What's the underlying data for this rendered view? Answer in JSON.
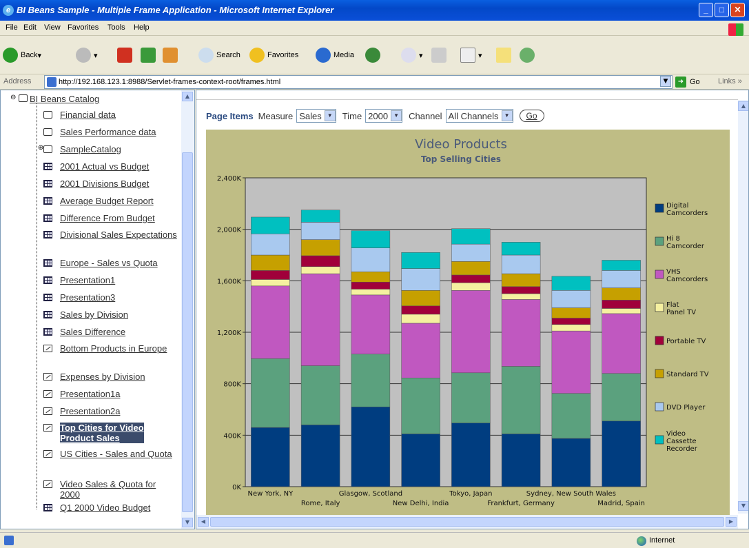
{
  "window": {
    "title": "BI Beans Sample - Multiple Frame Application - Microsoft Internet Explorer"
  },
  "menu": {
    "items": [
      "File",
      "Edit",
      "View",
      "Favorites",
      "Tools",
      "Help"
    ]
  },
  "toolbar": {
    "back": "Back",
    "search": "Search",
    "favorites": "Favorites",
    "media": "Media"
  },
  "address": {
    "label": "Address",
    "url": "http://192.168.123.1:8988/Servlet-frames-context-root/frames.html",
    "go": "Go",
    "links": "Links"
  },
  "tree": {
    "root": "BI Beans Catalog",
    "items": [
      {
        "label": "Financial data",
        "icon": "folder-icon"
      },
      {
        "label": "Sales Performance data",
        "icon": "folder-icon"
      },
      {
        "label": "SampleCatalog",
        "icon": "folder-icon"
      },
      {
        "label": "2001 Actual vs Budget",
        "icon": "table-icon"
      },
      {
        "label": "2001 Divisions Budget",
        "icon": "table-icon"
      },
      {
        "label": "Average Budget Report",
        "icon": "table-icon"
      },
      {
        "label": "Difference From Budget",
        "icon": "table-icon"
      },
      {
        "label": "Divisional Sales Expectations",
        "icon": "table-icon"
      },
      {
        "label": "Europe - Sales vs Quota",
        "icon": "table-icon"
      },
      {
        "label": "Presentation1",
        "icon": "table-icon"
      },
      {
        "label": "Presentation3",
        "icon": "table-icon"
      },
      {
        "label": "Sales by Division",
        "icon": "table-icon"
      },
      {
        "label": "Sales Difference",
        "icon": "table-icon"
      },
      {
        "label": "Bottom Products in Europe",
        "icon": "graph-icon"
      },
      {
        "label": "Expenses by Division",
        "icon": "graph-icon"
      },
      {
        "label": "Presentation1a",
        "icon": "graph-icon"
      },
      {
        "label": "Presentation2a",
        "icon": "graph-icon"
      },
      {
        "label": "Top Cities for Video Product Sales",
        "icon": "graph-icon",
        "selected": true
      },
      {
        "label": "US Cities - Sales and Quota",
        "icon": "graph-icon"
      },
      {
        "label": "Video Sales & Quota for 2000",
        "icon": "graph-icon"
      },
      {
        "label": "Q1 2000 Video Budget",
        "icon": "table-icon"
      }
    ]
  },
  "page_items": {
    "title": "Page Items",
    "measure_label": "Measure",
    "measure_value": "Sales",
    "time_label": "Time",
    "time_value": "2000",
    "channel_label": "Channel",
    "channel_value": "All Channels",
    "go": "Go"
  },
  "status": {
    "zone": "Internet"
  },
  "chart_data": {
    "type": "bar",
    "stacked": true,
    "title": "Video Products",
    "subtitle": "Top Selling Cities",
    "xlabel": "",
    "ylabel": "",
    "ylim": [
      0,
      2400000
    ],
    "yticks": [
      "0K",
      "400K",
      "800K",
      "1,200K",
      "1,600K",
      "2,000K",
      "2,400K"
    ],
    "grid": true,
    "legend_position": "right",
    "categories": [
      "New York, NY",
      "Rome, Italy",
      "Glasgow, Scotland",
      "New Delhi, India",
      "Tokyo, Japan",
      "Frankfurt, Germany",
      "Sydney, New South Wales",
      "Madrid, Spain"
    ],
    "series": [
      {
        "name": "Digital Camcorders",
        "color": "#003d80",
        "values": [
          460000,
          480000,
          620000,
          410000,
          495000,
          410000,
          375000,
          510000
        ]
      },
      {
        "name": "Hi 8 Camcorder",
        "color": "#5ba17e",
        "values": [
          535000,
          460000,
          410000,
          435000,
          390000,
          525000,
          350000,
          370000
        ]
      },
      {
        "name": "VHS Camcorders",
        "color": "#c058c0",
        "values": [
          565000,
          715000,
          460000,
          425000,
          640000,
          520000,
          485000,
          465000
        ]
      },
      {
        "name": "Flat Panel TV",
        "color": "#f5f0a0",
        "values": [
          50000,
          55000,
          45000,
          70000,
          60000,
          45000,
          50000,
          40000
        ]
      },
      {
        "name": "Portable TV",
        "color": "#a0003a",
        "values": [
          70000,
          85000,
          55000,
          65000,
          60000,
          55000,
          50000,
          65000
        ]
      },
      {
        "name": "Standard TV",
        "color": "#c6a000",
        "values": [
          120000,
          125000,
          80000,
          120000,
          105000,
          100000,
          80000,
          95000
        ]
      },
      {
        "name": "DVD Player",
        "color": "#a9c9ef",
        "values": [
          165000,
          135000,
          185000,
          170000,
          135000,
          145000,
          135000,
          135000
        ]
      },
      {
        "name": "Video Cassette Recorder",
        "color": "#00c0c0",
        "values": [
          130000,
          95000,
          135000,
          125000,
          120000,
          100000,
          110000,
          80000
        ]
      }
    ]
  }
}
